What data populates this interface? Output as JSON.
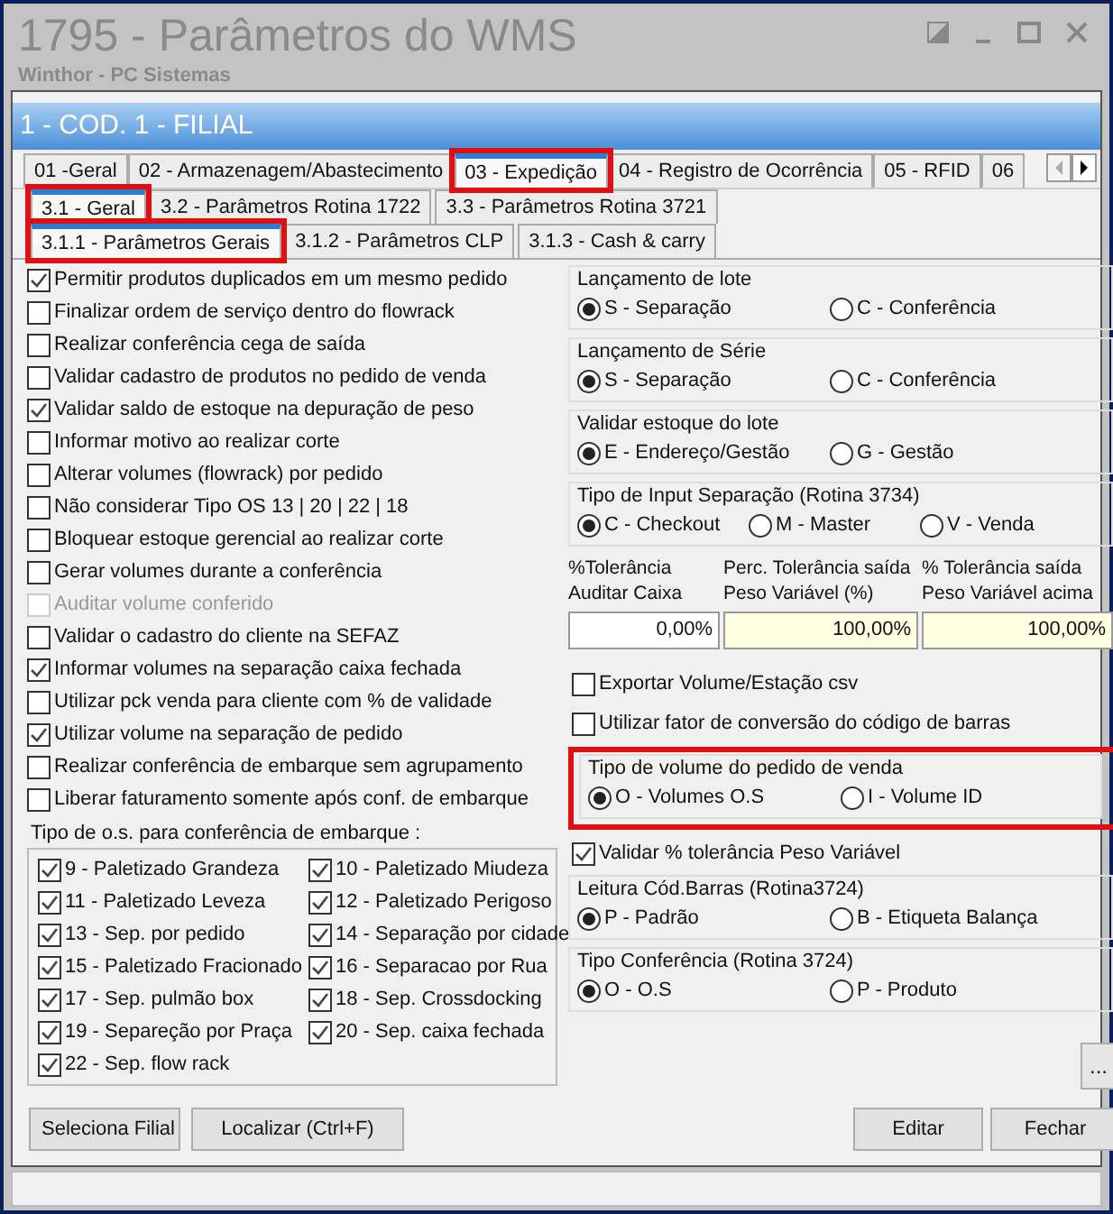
{
  "window": {
    "title": "1795 - Parâmetros do WMS",
    "subtitle": "Winthor - PC Sistemas"
  },
  "branch_header": "1 - COD. 1 - FILIAL",
  "tabs": [
    {
      "label": "01 -Geral",
      "selected": false,
      "highlighted": false
    },
    {
      "label": "02 - Armazenagem/Abastecimento",
      "selected": false,
      "highlighted": false
    },
    {
      "label": "03 - Expedição",
      "selected": true,
      "highlighted": true
    },
    {
      "label": "04 - Registro de Ocorrência",
      "selected": false,
      "highlighted": false
    },
    {
      "label": "05 - RFID",
      "selected": false,
      "highlighted": false
    },
    {
      "label": "06",
      "selected": false,
      "highlighted": false
    }
  ],
  "subtabs": [
    {
      "label": "3.1 - Geral",
      "selected": true,
      "highlighted": true
    },
    {
      "label": "3.2 - Parâmetros Rotina 1722",
      "selected": false,
      "highlighted": false
    },
    {
      "label": "3.3 - Parâmetros Rotina 3721",
      "selected": false,
      "highlighted": false
    }
  ],
  "subsubtabs": [
    {
      "label": "3.1.1 - Parâmetros Gerais",
      "selected": true,
      "highlighted": true
    },
    {
      "label": "3.1.2 - Parâmetros CLP",
      "selected": false,
      "highlighted": false
    },
    {
      "label": "3.1.3 - Cash & carry",
      "selected": false,
      "highlighted": false
    }
  ],
  "options": [
    {
      "label": "Permitir produtos duplicados em um mesmo pedido",
      "checked": true,
      "disabled": false
    },
    {
      "label": "Finalizar ordem de serviço dentro do flowrack",
      "checked": false,
      "disabled": false
    },
    {
      "label": "Realizar conferência cega de saída",
      "checked": false,
      "disabled": false
    },
    {
      "label": "Validar cadastro de produtos no pedido de venda",
      "checked": false,
      "disabled": false
    },
    {
      "label": "Validar saldo de estoque na depuração de peso",
      "checked": true,
      "disabled": false
    },
    {
      "label": "Informar motivo ao realizar corte",
      "checked": false,
      "disabled": false
    },
    {
      "label": "Alterar volumes (flowrack) por pedido",
      "checked": false,
      "disabled": false
    },
    {
      "label": "Não considerar Tipo OS 13 | 20 | 22 | 18",
      "checked": false,
      "disabled": false
    },
    {
      "label": "Bloquear estoque gerencial ao realizar corte",
      "checked": false,
      "disabled": false
    },
    {
      "label": "Gerar volumes durante a conferência",
      "checked": false,
      "disabled": false
    },
    {
      "label": "Auditar volume conferido",
      "checked": false,
      "disabled": true
    },
    {
      "label": "Validar o cadastro do cliente na SEFAZ",
      "checked": false,
      "disabled": false
    },
    {
      "label": "Informar volumes na separação caixa fechada",
      "checked": true,
      "disabled": false
    },
    {
      "label": "Utilizar pck venda para cliente com % de validade",
      "checked": false,
      "disabled": false
    },
    {
      "label": "Utilizar volume na separação de pedido",
      "checked": true,
      "disabled": false
    },
    {
      "label": "Realizar conferência de embarque sem agrupamento",
      "checked": false,
      "disabled": false
    },
    {
      "label": "Liberar faturamento somente após conf. de embarque",
      "checked": false,
      "disabled": false
    }
  ],
  "os_types": {
    "title": "Tipo de o.s. para conferência de embarque :",
    "items": [
      {
        "label": "9 - Paletizado Grandeza",
        "checked": true
      },
      {
        "label": "10 - Paletizado Miudeza",
        "checked": true
      },
      {
        "label": "11 - Paletizado Leveza",
        "checked": true
      },
      {
        "label": "12 - Paletizado Perigoso",
        "checked": true
      },
      {
        "label": "13 - Sep. por pedido",
        "checked": true
      },
      {
        "label": "14 - Separação por cidade",
        "checked": true
      },
      {
        "label": "15 - Paletizado Fracionado",
        "checked": true
      },
      {
        "label": "16 - Separacao por Rua",
        "checked": true
      },
      {
        "label": "17 - Sep. pulmão box",
        "checked": true
      },
      {
        "label": "18 - Sep. Crossdocking",
        "checked": true
      },
      {
        "label": "19 - Separeção por Praça",
        "checked": true
      },
      {
        "label": "20 - Sep. caixa fechada",
        "checked": true
      },
      {
        "label": "22 - Sep. flow rack",
        "checked": true
      }
    ]
  },
  "right_panel": [
    {
      "kind": "radio_group",
      "title": "Lançamento de lote",
      "highlighted": false,
      "options": [
        {
          "label": "S - Separação",
          "selected": true
        },
        {
          "label": "C - Conferência",
          "selected": false
        }
      ]
    },
    {
      "kind": "radio_group",
      "title": "Lançamento de Série",
      "highlighted": false,
      "options": [
        {
          "label": "S - Separação",
          "selected": true
        },
        {
          "label": "C - Conferência",
          "selected": false
        }
      ]
    },
    {
      "kind": "radio_group",
      "title": "Validar estoque do lote",
      "highlighted": false,
      "options": [
        {
          "label": "E - Endereço/Gestão",
          "selected": true
        },
        {
          "label": "G - Gestão",
          "selected": false
        }
      ]
    },
    {
      "kind": "radio_group",
      "title": "Tipo de Input Separação (Rotina 3734)",
      "highlighted": false,
      "options": [
        {
          "label": "C - Checkout",
          "selected": true
        },
        {
          "label": "M - Master",
          "selected": false
        },
        {
          "label": "V -  Venda",
          "selected": false
        }
      ]
    },
    {
      "kind": "tolerances",
      "fields": [
        {
          "label_1": "%Tolerância",
          "label_2": "Auditar Caixa",
          "value": "0,00%",
          "required": false
        },
        {
          "label_1": "Perc. Tolerância saída",
          "label_2": "Peso Variável (%)",
          "value": "100,00%",
          "required": true
        },
        {
          "label_1": "% Tolerância saída",
          "label_2": "Peso Variável acima",
          "value": "100,00%",
          "required": true
        }
      ]
    },
    {
      "kind": "checkbox",
      "label": "Exportar Volume/Estação csv",
      "checked": false
    },
    {
      "kind": "checkbox",
      "label": "Utilizar fator de conversão do código de barras",
      "checked": false
    },
    {
      "kind": "radio_group",
      "title": "Tipo de volume do pedido de venda",
      "highlighted": true,
      "options": [
        {
          "label": "O - Volumes O.S",
          "selected": true
        },
        {
          "label": "I - Volume ID",
          "selected": false
        }
      ]
    },
    {
      "kind": "checkbox",
      "label": "Validar % tolerância Peso Variável",
      "checked": true
    },
    {
      "kind": "radio_group",
      "title": "Leitura Cód.Barras (Rotina3724)",
      "highlighted": false,
      "options": [
        {
          "label": "P - Padrão",
          "selected": true
        },
        {
          "label": "B - Etiqueta Balança",
          "selected": false
        }
      ]
    },
    {
      "kind": "radio_group",
      "title": "Tipo Conferência (Rotina 3724)",
      "highlighted": false,
      "options": [
        {
          "label": "O - O.S",
          "selected": true
        },
        {
          "label": "P - Produto",
          "selected": false
        }
      ]
    }
  ],
  "more_button": "...",
  "buttons_left": [
    "Seleciona Filial",
    "Localizar (Ctrl+F)"
  ],
  "buttons_right": [
    "Editar",
    "Fechar"
  ]
}
